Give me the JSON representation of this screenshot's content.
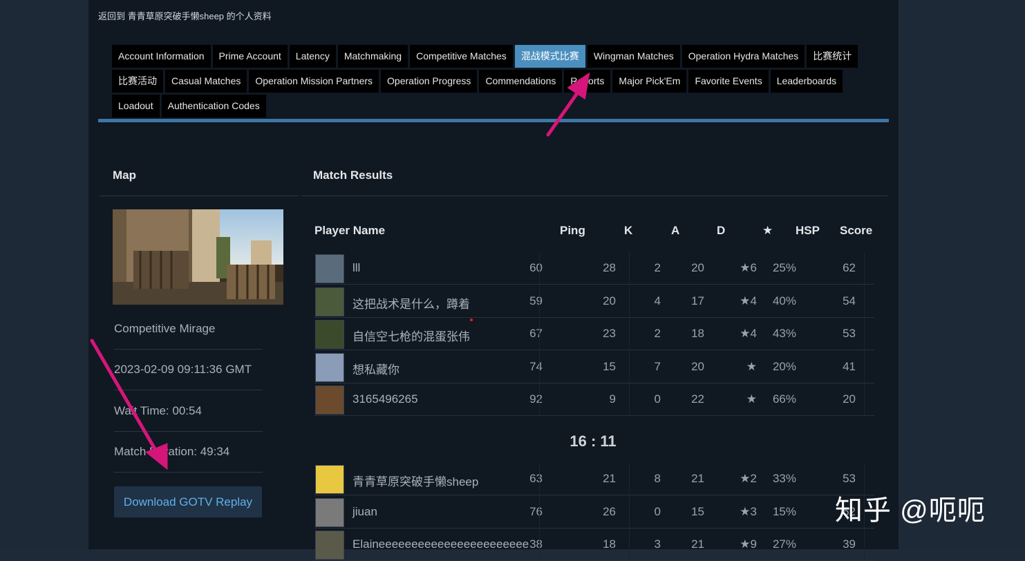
{
  "back_link": "返回到 青青草原突破手懒sheep 的个人资料",
  "tabs": [
    {
      "label": "Account Information"
    },
    {
      "label": "Prime Account"
    },
    {
      "label": "Latency"
    },
    {
      "label": "Matchmaking"
    },
    {
      "label": "Competitive Matches"
    },
    {
      "label": "混战模式比赛",
      "active": true
    },
    {
      "label": "Wingman Matches"
    },
    {
      "label": "Operation Hydra Matches"
    },
    {
      "label": "比赛统计"
    },
    {
      "label": "比赛活动"
    },
    {
      "label": "Casual Matches"
    },
    {
      "label": "Operation Mission Partners"
    },
    {
      "label": "Operation Progress"
    },
    {
      "label": "Commendations"
    },
    {
      "label": "Reports"
    },
    {
      "label": "Major Pick'Em"
    },
    {
      "label": "Favorite Events"
    },
    {
      "label": "Leaderboards"
    },
    {
      "label": "Loadout"
    },
    {
      "label": "Authentication Codes"
    }
  ],
  "map_panel": {
    "header": "Map",
    "map_name": "Competitive Mirage",
    "date": "2023-02-09 09:11:36 GMT",
    "wait_time": "Wait Time: 00:54",
    "match_duration": "Match Duration: 49:34",
    "download_label": "Download GOTV Replay"
  },
  "results": {
    "header": "Match Results",
    "columns": {
      "player": "Player Name",
      "ping": "Ping",
      "k": "K",
      "a": "A",
      "d": "D",
      "star": "★",
      "hsp": "HSP",
      "score": "Score"
    },
    "team1": [
      {
        "name": "lll",
        "ping": "60",
        "k": "28",
        "a": "2",
        "d": "20",
        "star": "★6",
        "hsp": "25%",
        "score": "62"
      },
      {
        "name": "这把战术是什么，蹲着",
        "ping": "59",
        "k": "20",
        "a": "4",
        "d": "17",
        "star": "★4",
        "hsp": "40%",
        "score": "54"
      },
      {
        "name": "自信空七枪的混蛋张伟",
        "ping": "67",
        "k": "23",
        "a": "2",
        "d": "18",
        "star": "★4",
        "hsp": "43%",
        "score": "53"
      },
      {
        "name": "想私藏你",
        "ping": "74",
        "k": "15",
        "a": "7",
        "d": "20",
        "star": "★",
        "hsp": "20%",
        "score": "41"
      },
      {
        "name": "3165496265",
        "ping": "92",
        "k": "9",
        "a": "0",
        "d": "22",
        "star": "★",
        "hsp": "66%",
        "score": "20"
      }
    ],
    "score_line": "16 : 11",
    "team2": [
      {
        "name": "青青草原突破手懒sheep",
        "ping": "63",
        "k": "21",
        "a": "8",
        "d": "21",
        "star": "★2",
        "hsp": "33%",
        "score": "53"
      },
      {
        "name": "jiuan",
        "ping": "76",
        "k": "26",
        "a": "0",
        "d": "15",
        "star": "★3",
        "hsp": "15%",
        "score": "52"
      },
      {
        "name": "Elaineeeeeeeeeeeeeeeeeeeeeee",
        "ping": "38",
        "k": "18",
        "a": "3",
        "d": "21",
        "star": "★9",
        "hsp": "27%",
        "score": "39"
      }
    ]
  },
  "watermark": "知乎 @呃呃",
  "colors": {
    "accent": "#4b8fbf",
    "link": "#5fb0e9",
    "arrow": "#d6157a"
  }
}
